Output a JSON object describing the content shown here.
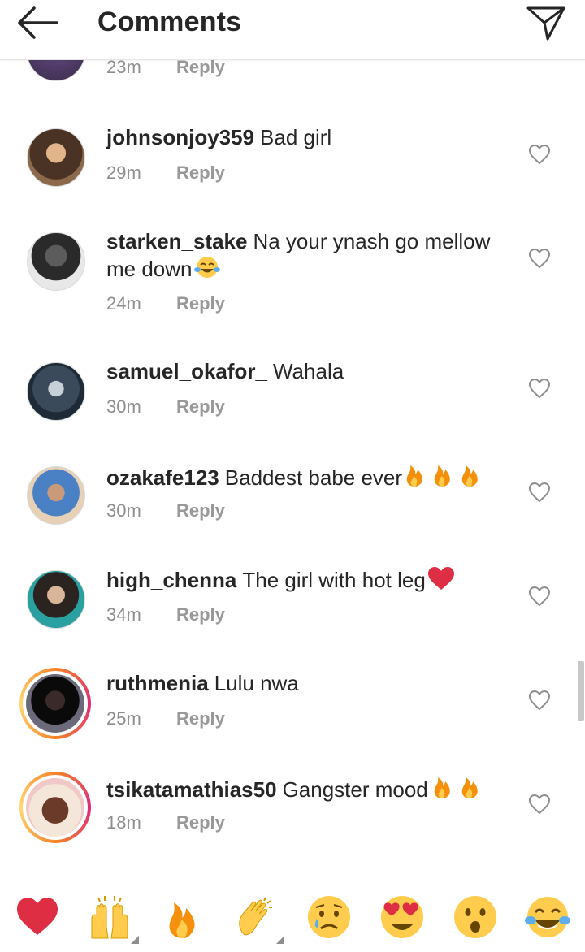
{
  "header": {
    "title": "Comments"
  },
  "top_partial": {
    "time": "23m",
    "reply_label": "Reply"
  },
  "comments": [
    {
      "username": "johnsonjoy359",
      "text": "Bad girl",
      "time": "29m",
      "reply_label": "Reply"
    },
    {
      "username": "starken_stake",
      "text": "Na your ynash go mellow me down",
      "time": "24m",
      "reply_label": "Reply"
    },
    {
      "username": "samuel_okafor_",
      "text": "Wahala",
      "time": "30m",
      "reply_label": "Reply"
    },
    {
      "username": "ozakafe123",
      "text": "Baddest babe ever",
      "time": "30m",
      "reply_label": "Reply"
    },
    {
      "username": "high_chenna",
      "text": "The girl with hot leg",
      "time": "34m",
      "reply_label": "Reply"
    },
    {
      "username": "ruthmenia",
      "text": "Lulu nwa",
      "time": "25m",
      "reply_label": "Reply"
    },
    {
      "username": "tsikatamathias50",
      "text": "Gangster mood",
      "time": "18m",
      "reply_label": "Reply"
    }
  ],
  "emoji_bar": [
    "red-heart",
    "raising-hands",
    "fire",
    "clapping-hands",
    "crying-face",
    "heart-eyes-face",
    "astonished-face",
    "tears-of-joy-face"
  ],
  "colors": {
    "text": "#262626",
    "secondary": "#8e8e8e",
    "reply": "#999999",
    "heart": "#dd2e44",
    "fire": "#f4900c"
  }
}
